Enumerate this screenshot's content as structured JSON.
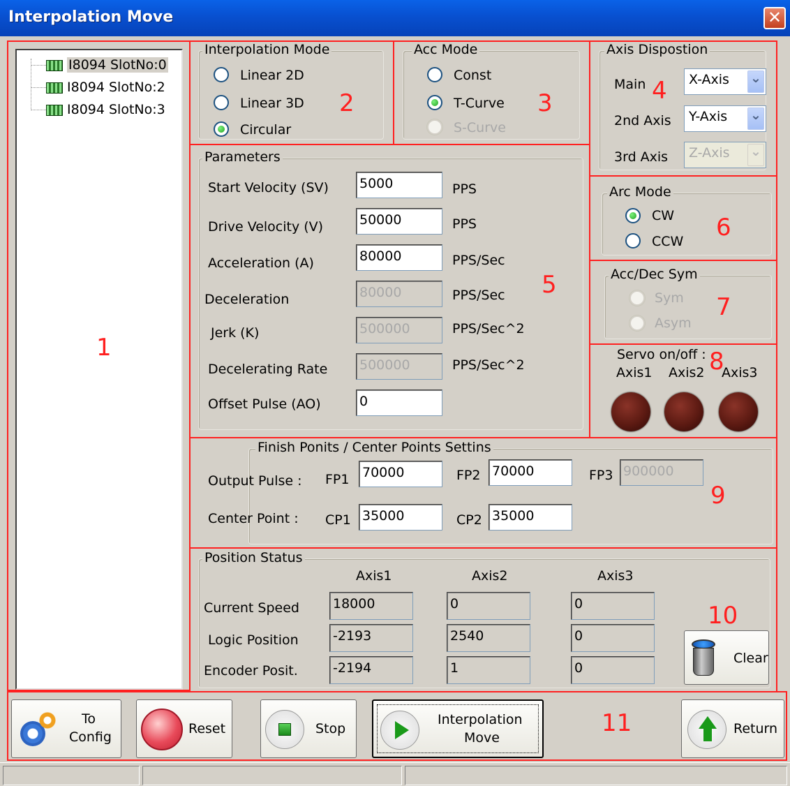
{
  "window": {
    "title": "Interpolation Move",
    "close_glyph": "✕"
  },
  "tree": {
    "items": [
      {
        "label": "I8094 SlotNo:0",
        "selected": true
      },
      {
        "label": "I8094 SlotNo:2",
        "selected": false
      },
      {
        "label": "I8094 SlotNo:3",
        "selected": false
      }
    ]
  },
  "region_numbers": [
    "1",
    "2",
    "3",
    "4",
    "5",
    "6",
    "7",
    "8",
    "9",
    "10",
    "11"
  ],
  "interp_mode": {
    "title": "Interpolation Mode",
    "options": [
      {
        "label": "Linear 2D",
        "selected": false
      },
      {
        "label": "Linear 3D",
        "selected": false
      },
      {
        "label": "Circular",
        "selected": true
      }
    ]
  },
  "acc_mode": {
    "title": "Acc Mode",
    "options": [
      {
        "label": "Const",
        "selected": false,
        "enabled": true
      },
      {
        "label": "T-Curve",
        "selected": true,
        "enabled": true
      },
      {
        "label": "S-Curve",
        "selected": false,
        "enabled": false
      }
    ]
  },
  "axis_disposition": {
    "title": "Axis Dispostion",
    "rows": [
      {
        "label": "Main",
        "value": "X-Axis",
        "enabled": true
      },
      {
        "label": "2nd Axis",
        "value": "Y-Axis",
        "enabled": true
      },
      {
        "label": "3rd Axis",
        "value": "Z-Axis",
        "enabled": false
      }
    ],
    "arrow_glyph": "⌄"
  },
  "parameters": {
    "title": "Parameters",
    "rows": [
      {
        "label": "Start Velocity (SV)",
        "value": "5000",
        "unit": "PPS",
        "enabled": true
      },
      {
        "label": "Drive Velocity (V)",
        "value": "50000",
        "unit": "PPS",
        "enabled": true
      },
      {
        "label": "Acceleration (A)",
        "value": "80000",
        "unit": "PPS/Sec",
        "enabled": true
      },
      {
        "label": "Deceleration",
        "value": "80000",
        "unit": "PPS/Sec",
        "enabled": false
      },
      {
        "label": "Jerk (K)",
        "value": "500000",
        "unit": "PPS/Sec^2",
        "enabled": false
      },
      {
        "label": "Decelerating Rate",
        "value": "500000",
        "unit": "PPS/Sec^2",
        "enabled": false
      },
      {
        "label": "Offset Pulse (AO)",
        "value": "0",
        "unit": "",
        "enabled": true
      }
    ]
  },
  "arc_mode": {
    "title": "Arc Mode",
    "options": [
      {
        "label": "CW",
        "selected": true
      },
      {
        "label": "CCW",
        "selected": false
      }
    ]
  },
  "acc_dec_sym": {
    "title": "Acc/Dec Sym",
    "options": [
      {
        "label": "Sym",
        "enabled": false
      },
      {
        "label": "Asym",
        "enabled": false
      }
    ]
  },
  "servo": {
    "title": "Servo on/off :",
    "axes": [
      "Axis1",
      "Axis2",
      "Axis3"
    ]
  },
  "finish_points": {
    "title": "Finish Ponits / Center Points Settins",
    "output_label": "Output Pulse :",
    "center_label": "Center Point :",
    "fp": [
      {
        "label": "FP1",
        "value": "70000",
        "enabled": true
      },
      {
        "label": "FP2",
        "value": "70000",
        "enabled": true
      },
      {
        "label": "FP3",
        "value": "900000",
        "enabled": false
      }
    ],
    "cp": [
      {
        "label": "CP1",
        "value": "35000"
      },
      {
        "label": "CP2",
        "value": "35000"
      }
    ]
  },
  "position_status": {
    "title": "Position Status",
    "columns": [
      "Axis1",
      "Axis2",
      "Axis3"
    ],
    "rows": [
      {
        "label": "Current Speed",
        "values": [
          "18000",
          "0",
          "0"
        ]
      },
      {
        "label": "Logic Position",
        "values": [
          "-2193",
          "2540",
          "0"
        ]
      },
      {
        "label": "Encoder Posit.",
        "values": [
          "-2194",
          "1",
          "0"
        ]
      }
    ],
    "clear_label": "Clear"
  },
  "buttons": {
    "to_config_line1": "To",
    "to_config_line2": "Config",
    "reset": "Reset",
    "stop": "Stop",
    "interp_line1": "Interpolation",
    "interp_line2": "Move",
    "return": "Return"
  },
  "colors": {
    "region_border": "#ff2020",
    "region_number": "#ff1f1f",
    "title_bar": "#0850d0",
    "window_bg": "#d4d0c8"
  }
}
